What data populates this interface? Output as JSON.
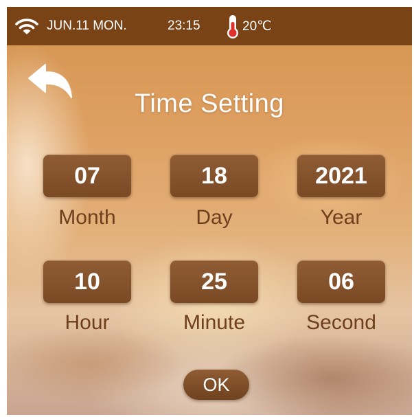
{
  "status_bar": {
    "date": "JUN.11 MON.",
    "time": "23:15",
    "temperature": "20℃",
    "icons": [
      "wifi-icon",
      "thermometer-icon"
    ]
  },
  "header": {
    "title": "Time Setting",
    "back_icon": "back-arrow-icon"
  },
  "fields": {
    "month": {
      "value": "07",
      "label": "Month"
    },
    "day": {
      "value": "18",
      "label": "Day"
    },
    "year": {
      "value": "2021",
      "label": "Year"
    },
    "hour": {
      "value": "10",
      "label": "Hour"
    },
    "minute": {
      "value": "25",
      "label": "Minute"
    },
    "second": {
      "value": "06",
      "label": "Second"
    }
  },
  "actions": {
    "ok_label": "OK"
  },
  "colors": {
    "status_bar": "#7a4316",
    "field_bg": "#8a5630",
    "label_text": "#6e3f1c",
    "text_light": "#ffffff"
  }
}
